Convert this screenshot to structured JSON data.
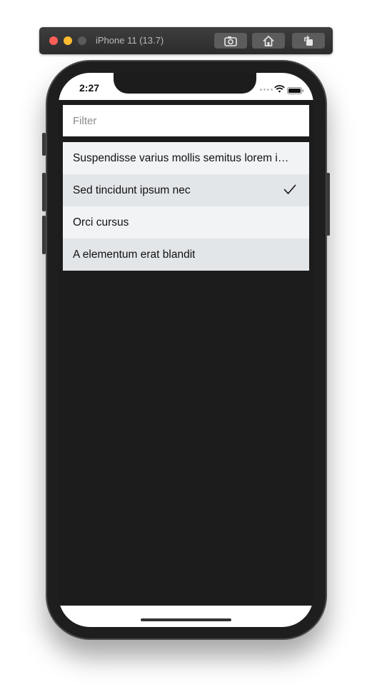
{
  "simulator": {
    "title": "iPhone 11 (13.7)",
    "buttons": {
      "screenshot_icon": "camera-icon",
      "home_icon": "home-icon",
      "rotate_icon": "rotate-icon"
    }
  },
  "status_bar": {
    "time": "2:27"
  },
  "filter": {
    "placeholder": "Filter",
    "value": ""
  },
  "list": {
    "items": [
      {
        "label": "Suspendisse varius mollis semitus lorem i…",
        "selected": false
      },
      {
        "label": "Sed tincidunt ipsum nec",
        "selected": true
      },
      {
        "label": "Orci cursus",
        "selected": false
      },
      {
        "label": "A elementum erat blandit",
        "selected": false
      }
    ]
  },
  "colors": {
    "row_light": "#f2f3f5",
    "row_dark": "#e3e6e9",
    "screen_bg": "#1c1c1c"
  }
}
